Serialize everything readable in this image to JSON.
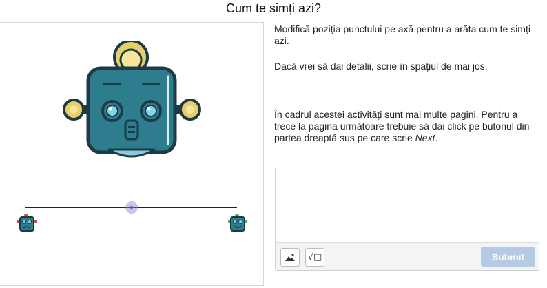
{
  "page": {
    "title": "Cum te simți azi?"
  },
  "instructions": {
    "line1": "Modifică poziția punctului pe axă pentru a arăta cum te simți azi.",
    "line2": "Dacă vrei să dai detalii, scrie în spațiul de mai jos.",
    "line3_prefix": "În cadrul acestei activități sunt mai multe pagini. Pentru a trece la pagina următoare trebuie să dai click pe butonul din partea dreaptă sus pe care scrie ",
    "line3_emph": "Next",
    "line3_suffix": "."
  },
  "slider": {
    "value": 0.5,
    "left_icon": "robot-icon",
    "right_icon": "robot-icon"
  },
  "answer": {
    "value": "",
    "placeholder": "",
    "image_tool_icon": "image-icon",
    "math_tool_label": "√□",
    "submit_label": "Submit"
  },
  "colors": {
    "robot_body": "#2e7d8f",
    "robot_outline": "#1b3b45",
    "robot_ear": "#e9cf6b",
    "handle": "#9b85d6",
    "submit": "#b3cbe5"
  }
}
